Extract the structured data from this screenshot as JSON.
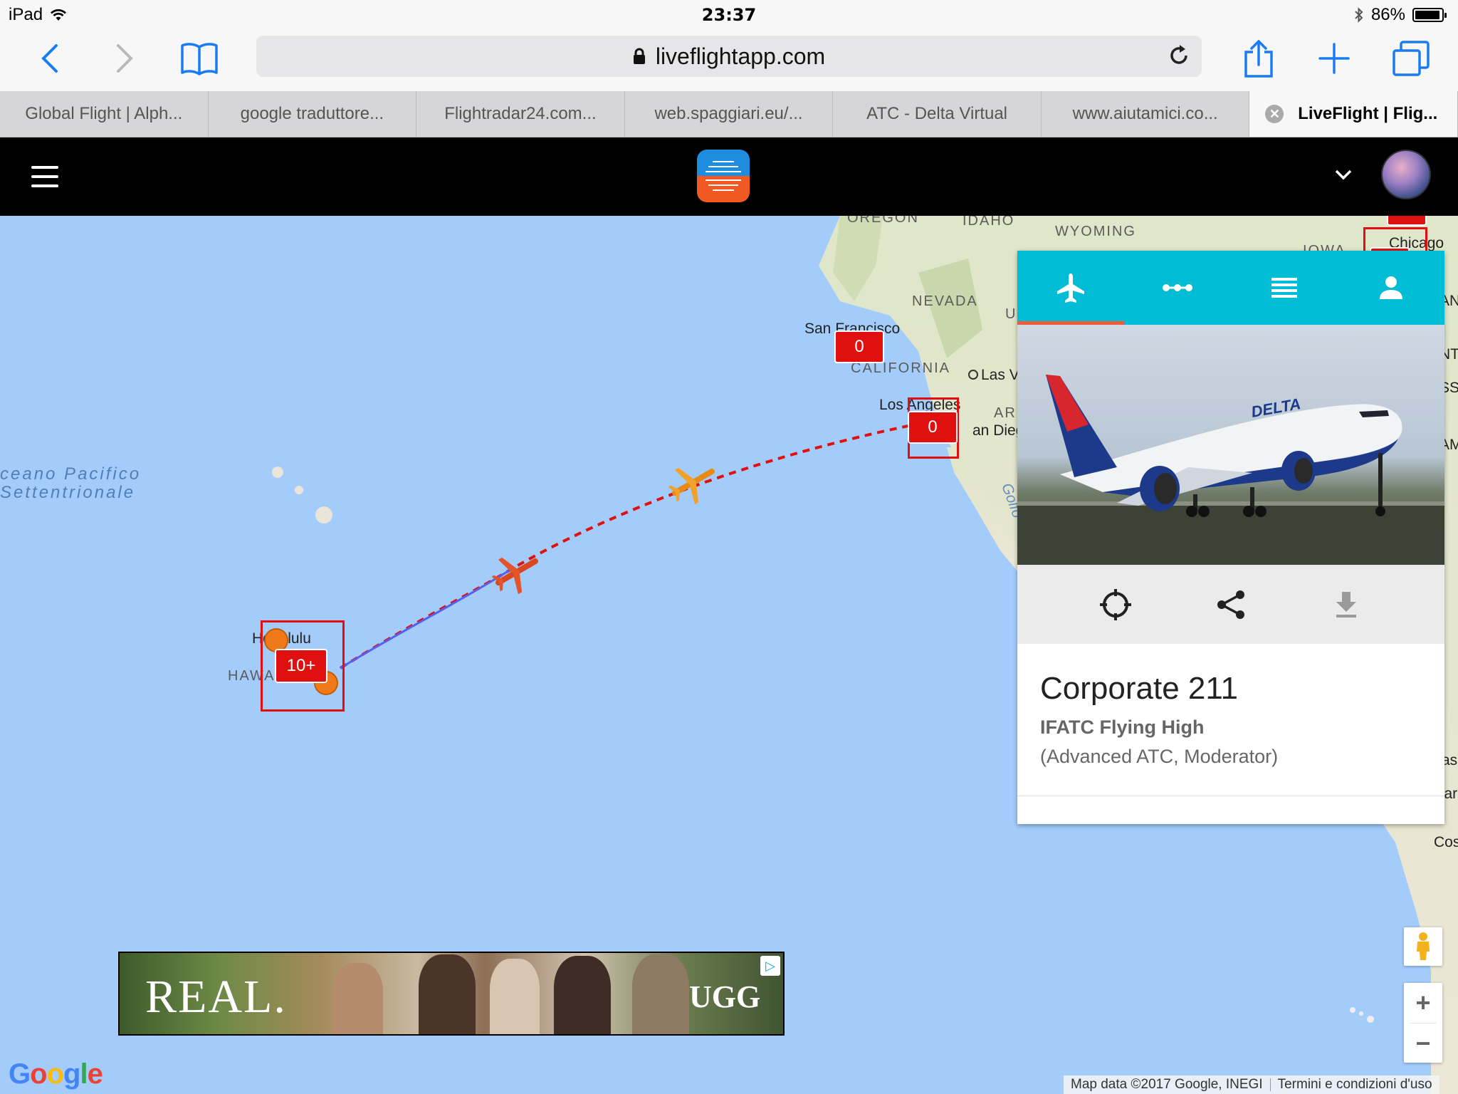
{
  "status_bar": {
    "device": "iPad",
    "time": "23:37",
    "battery": "86%",
    "battery_level": 0.86
  },
  "browser": {
    "url": "liveflightapp.com",
    "tabs": [
      {
        "label": "Global Flight | Alph..."
      },
      {
        "label": "google traduttore..."
      },
      {
        "label": "Flightradar24.com..."
      },
      {
        "label": "web.spaggiari.eu/..."
      },
      {
        "label": "ATC - Delta Virtual"
      },
      {
        "label": "www.aiutamici.co..."
      },
      {
        "label": "LiveFlight | Flig..."
      }
    ]
  },
  "map": {
    "ocean_label_line1": "ceano Pacifico",
    "ocean_label_line2": "Settentrionale",
    "places": {
      "oregon": "OREGON",
      "idaho": "IDAHO",
      "wyoming": "WYOMING",
      "iowa": "IOWA",
      "chicago": "Chicago",
      "nevada": "NEVADA",
      "san_francisco": "San Francisco",
      "california": "CALIFORNIA",
      "las_vegas": "Las V",
      "los_angeles": "Los Angeles",
      "san_diego": "an Diego",
      "arizona": "ARI",
      "golfo": "Golfo",
      "utah": "U",
      "honolulu": "Honolulu",
      "hawaii": "HAWAII",
      "right_edge_1": "AN",
      "right_edge_2": "NT",
      "right_edge_3": "SS",
      "right_edge_4": "AM",
      "right_edge_5": "ras",
      "right_edge_6": "car",
      "right_edge_7": "Cos"
    },
    "clusters": {
      "san_francisco": "0",
      "los_angeles": "0",
      "hawaii": "10+"
    },
    "attribution": "Map data ©2017 Google, INEGI",
    "terms": "Termini e condizioni d'uso",
    "google_logo": [
      "G",
      "o",
      "o",
      "g",
      "l",
      "e"
    ],
    "zoom_in": "+",
    "zoom_out": "−"
  },
  "panel": {
    "callsign": "Corporate 211",
    "pilot": "IFATC Flying High",
    "role": "(Advanced ATC, Moderator)",
    "livery_text": "DELTA"
  },
  "ad": {
    "headline": "REAL.",
    "brand": "UGG"
  },
  "colors": {
    "ocean": "#a3ccfb",
    "land": "#e9e5d8",
    "route": "#e01010",
    "panel_tabs": "#00bcd4",
    "panel_tab_underline": "#ef5a3a",
    "cluster": "#e01010",
    "plane_orange": "#f2a12a",
    "plane_red": "#e4532a"
  },
  "icons": [
    "back-icon",
    "forward-icon",
    "bookmarks-icon",
    "lock-icon",
    "reload-icon",
    "share-icon",
    "new-tab-icon",
    "tabs-icon",
    "menu-icon",
    "chevron-down-icon",
    "plane-icon",
    "route-icon",
    "list-icon",
    "person-icon",
    "locate-icon",
    "share-icon",
    "download-icon",
    "pegman-icon"
  ]
}
